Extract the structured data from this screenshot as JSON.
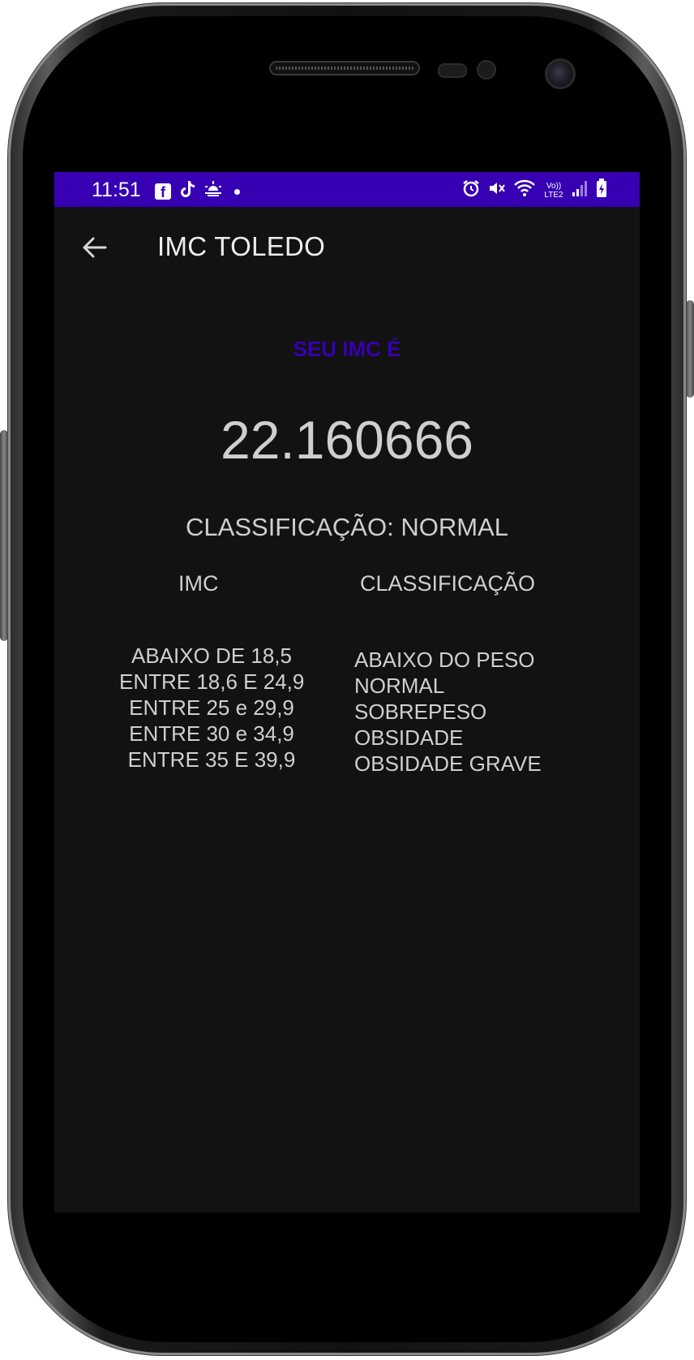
{
  "status_bar": {
    "time": "11:51",
    "left_icons": [
      "facebook-icon",
      "tiktok-icon",
      "weather-icon",
      "dot-icon"
    ],
    "right_icons": [
      "alarm-icon",
      "mute-icon",
      "wifi-icon",
      "volte-icon",
      "signal-icon",
      "battery-icon"
    ],
    "volte_label": "Vo)) LTE2",
    "background_color": "#3700b3"
  },
  "app_bar": {
    "title": "IMC TOLEDO",
    "back_icon": "arrow-left-icon"
  },
  "result": {
    "label": "SEU IMC É",
    "value": "22.160666",
    "classification": "CLASSIFICAÇÃO: NORMAL",
    "label_color": "#3700b3"
  },
  "table": {
    "header_imc": "IMC",
    "header_classification": "CLASSIFICAÇÃO",
    "ranges": [
      "ABAIXO DE 18,5",
      "ENTRE 18,6 E 24,9",
      "ENTRE 25 e 29,9",
      "ENTRE 30 e 34,9",
      "ENTRE 35 E 39,9"
    ],
    "classes": [
      "ABAIXO DO PESO",
      "NORMAL",
      "SOBREPESO",
      "OBSIDADE",
      "OBSIDADE GRAVE"
    ]
  }
}
